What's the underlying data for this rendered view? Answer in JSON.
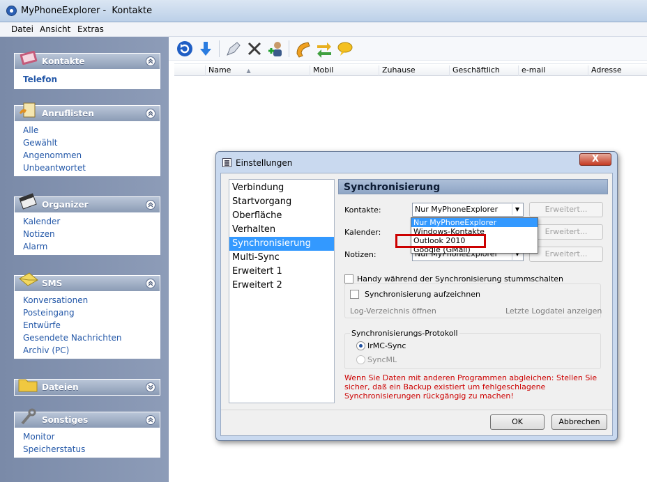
{
  "window": {
    "title": "MyPhoneExplorer -  Kontakte"
  },
  "menu": [
    "Datei",
    "Ansicht",
    "Extras"
  ],
  "sidebar": {
    "panels": [
      {
        "title": "Kontakte",
        "icon": "address-book-icon",
        "items": [
          "Telefon"
        ]
      },
      {
        "title": "Anruflisten",
        "icon": "phone-list-icon",
        "items": [
          "Alle",
          "Gewählt",
          "Angenommen",
          "Unbeantwortet"
        ]
      },
      {
        "title": "Organizer",
        "icon": "calendar-icon",
        "items": [
          "Kalender",
          "Notizen",
          "Alarm"
        ]
      },
      {
        "title": "SMS",
        "icon": "envelope-icon",
        "items": [
          "Konversationen",
          "Posteingang",
          "Entwürfe",
          "Gesendete Nachrichten",
          "Archiv (PC)"
        ]
      },
      {
        "title": "Dateien",
        "icon": "folder-icon",
        "items": []
      },
      {
        "title": "Sonstiges",
        "icon": "wrench-icon",
        "items": [
          "Monitor",
          "Speicherstatus"
        ]
      }
    ]
  },
  "toolbar": {
    "icons": [
      "refresh-icon",
      "download-icon",
      "edit-icon",
      "delete-icon",
      "add-contact-icon",
      "call-icon",
      "sync-icon",
      "message-icon"
    ]
  },
  "table": {
    "columns": [
      "Name",
      "Mobil",
      "Zuhause",
      "Geschäftlich",
      "e-mail",
      "Adresse"
    ]
  },
  "dialog": {
    "title": "Einstellungen",
    "close": "X",
    "nav": [
      "Verbindung",
      "Startvorgang",
      "Oberfläche",
      "Verhalten",
      "Synchronisierung",
      "Multi-Sync",
      "Erweitert 1",
      "Erweitert 2"
    ],
    "nav_selected": "Synchronisierung",
    "section_title": "Synchronisierung",
    "rows": [
      {
        "label": "Kontakte:",
        "value": "Nur MyPhoneExplorer",
        "button": "Erweitert..."
      },
      {
        "label": "Kalender:",
        "value": "",
        "button": "Erweitert..."
      },
      {
        "label": "Notizen:",
        "value": "Nur MyPhoneExplorer",
        "button": "Erweitert..."
      }
    ],
    "dropdown_options": [
      "Nur MyPhoneExplorer",
      "Windows-Kontakte",
      "Outlook 2010",
      "Google (GMail)"
    ],
    "dropdown_selected": "Nur MyPhoneExplorer",
    "highlighted_option": "Outlook 2010",
    "mute_checkbox": "Handy während der Synchronisierung stummschalten",
    "record_checkbox": "Synchronisierung aufzeichnen",
    "log_dir": "Log-Verzeichnis öffnen",
    "last_log": "Letzte Logdatei anzeigen",
    "protocol_title": "Synchronisierungs-Protokoll",
    "protocols": [
      "IrMC-Sync",
      "SyncML"
    ],
    "protocol_selected": "IrMC-Sync",
    "warning": [
      "Wenn Sie Daten mit anderen Programmen abgleichen: Stellen Sie",
      "sicher, daß ein Backup existiert um fehlgeschlagene",
      "Synchronisierungen rückgängig zu machen!"
    ],
    "ok": "OK",
    "cancel": "Abbrechen"
  },
  "colors": {
    "accent": "#3399ff",
    "warning": "#cc0000",
    "link": "#2458a8"
  }
}
